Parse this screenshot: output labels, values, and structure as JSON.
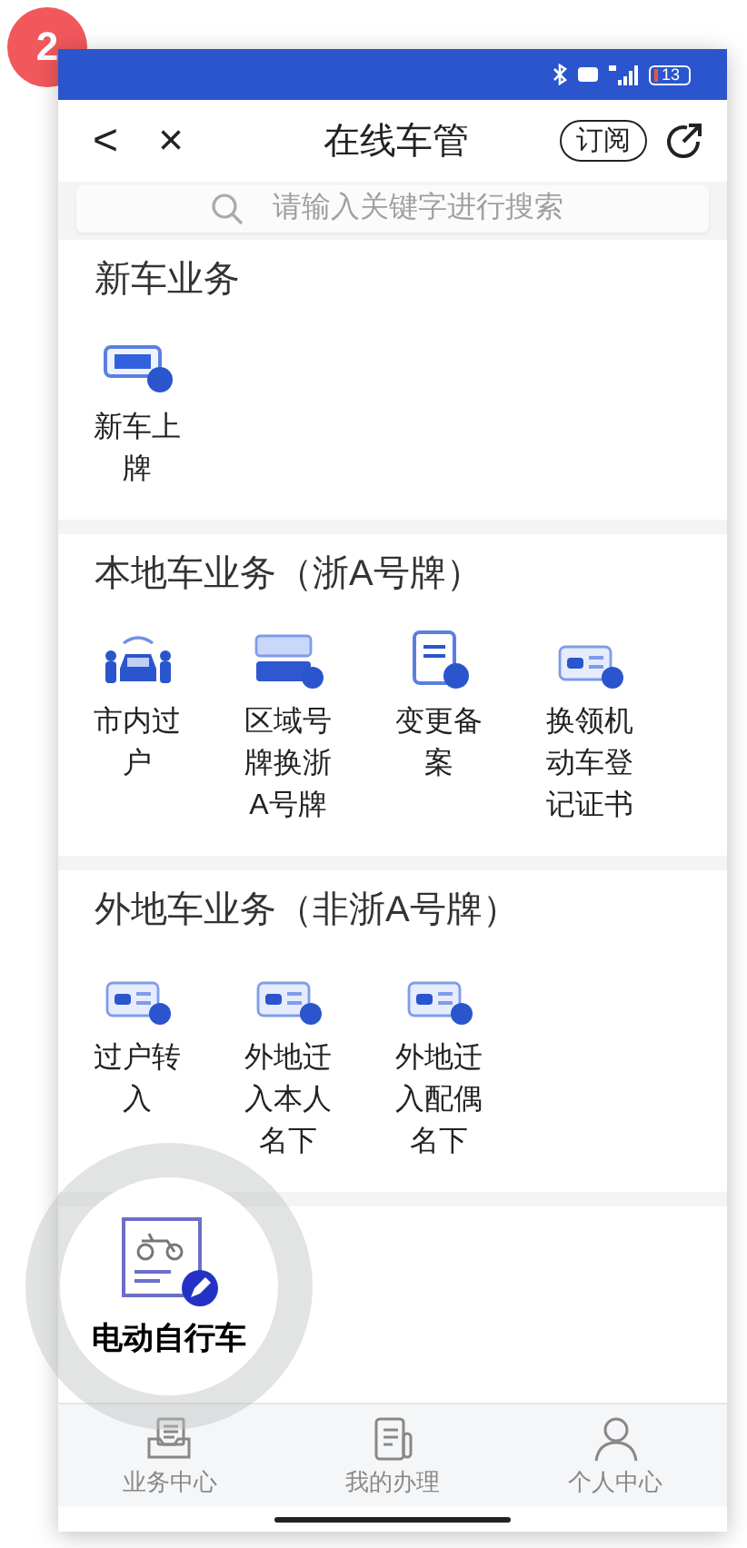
{
  "step_badge": "2",
  "status_bar": {
    "battery": "13"
  },
  "nav": {
    "back": "<",
    "close": "×",
    "title": "在线车管",
    "subscribe": "订阅"
  },
  "search": {
    "placeholder": "请输入关键字进行搜索"
  },
  "sections": [
    {
      "title": "新车业务",
      "tiles": [
        {
          "label": "新车上牌"
        }
      ]
    },
    {
      "title": "本地车业务（浙A号牌）",
      "tiles": [
        {
          "label": "市内过户"
        },
        {
          "label": "区域号牌换浙A号牌"
        },
        {
          "label": "变更备案"
        },
        {
          "label": "换领机动车登记证书"
        }
      ]
    },
    {
      "title": "外地车业务（非浙A号牌）",
      "tiles": [
        {
          "label": "过户转入"
        },
        {
          "label": "外地迁入本人名下"
        },
        {
          "label": "外地迁入配偶名下"
        }
      ]
    }
  ],
  "magnifier": {
    "label": "电动自行车"
  },
  "tab_bar": [
    {
      "label": "业务中心",
      "selected": false
    },
    {
      "label": "我的办理",
      "selected": false
    },
    {
      "label": "个人中心",
      "selected": false
    }
  ]
}
